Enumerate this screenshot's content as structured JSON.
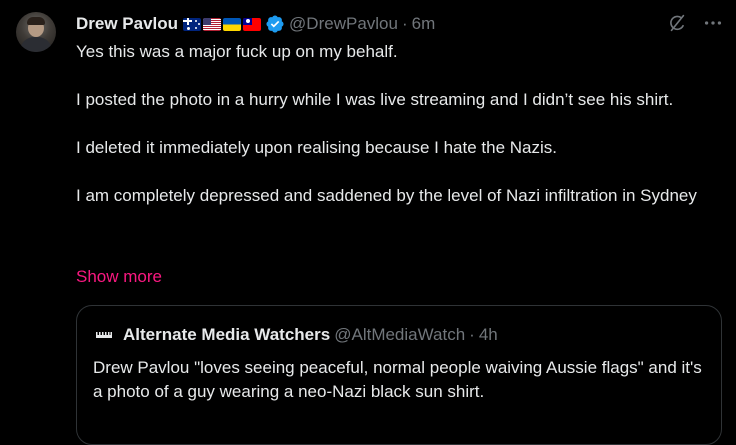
{
  "post": {
    "author": {
      "display_name": "Drew Pavlou",
      "handle": "@DrewPavlou",
      "flags": [
        "flag-australia",
        "flag-usa",
        "flag-ukraine",
        "flag-taiwan"
      ],
      "verified": true
    },
    "separator": "·",
    "time": "6m",
    "paragraphs": [
      "Yes this was a major fuck up on my behalf.",
      "I posted the photo in a hurry while I was live streaming and I didn’t see his shirt.",
      "I deleted it immediately upon realising because I hate the Nazis.",
      "I am completely depressed and saddened by the level of Nazi infiltration in Sydney"
    ],
    "show_more": "Show more",
    "icons": [
      "grok-icon",
      "more-options-icon"
    ]
  },
  "quote": {
    "author": {
      "display_name": "Alternate Media Watchers",
      "handle": "@AltMediaWatch"
    },
    "separator": "·",
    "time": "4h",
    "text": "Drew Pavlou \"loves seeing peaceful, normal people waiving Aussie flags\" and it's a photo of a guy wearing a neo-Nazi black sun shirt."
  },
  "colors": {
    "background": "#000000",
    "text": "#e7e9ea",
    "secondary_text": "#71767b",
    "link": "#f91880",
    "verified": "#1d9bf0",
    "border": "#2f3336"
  }
}
